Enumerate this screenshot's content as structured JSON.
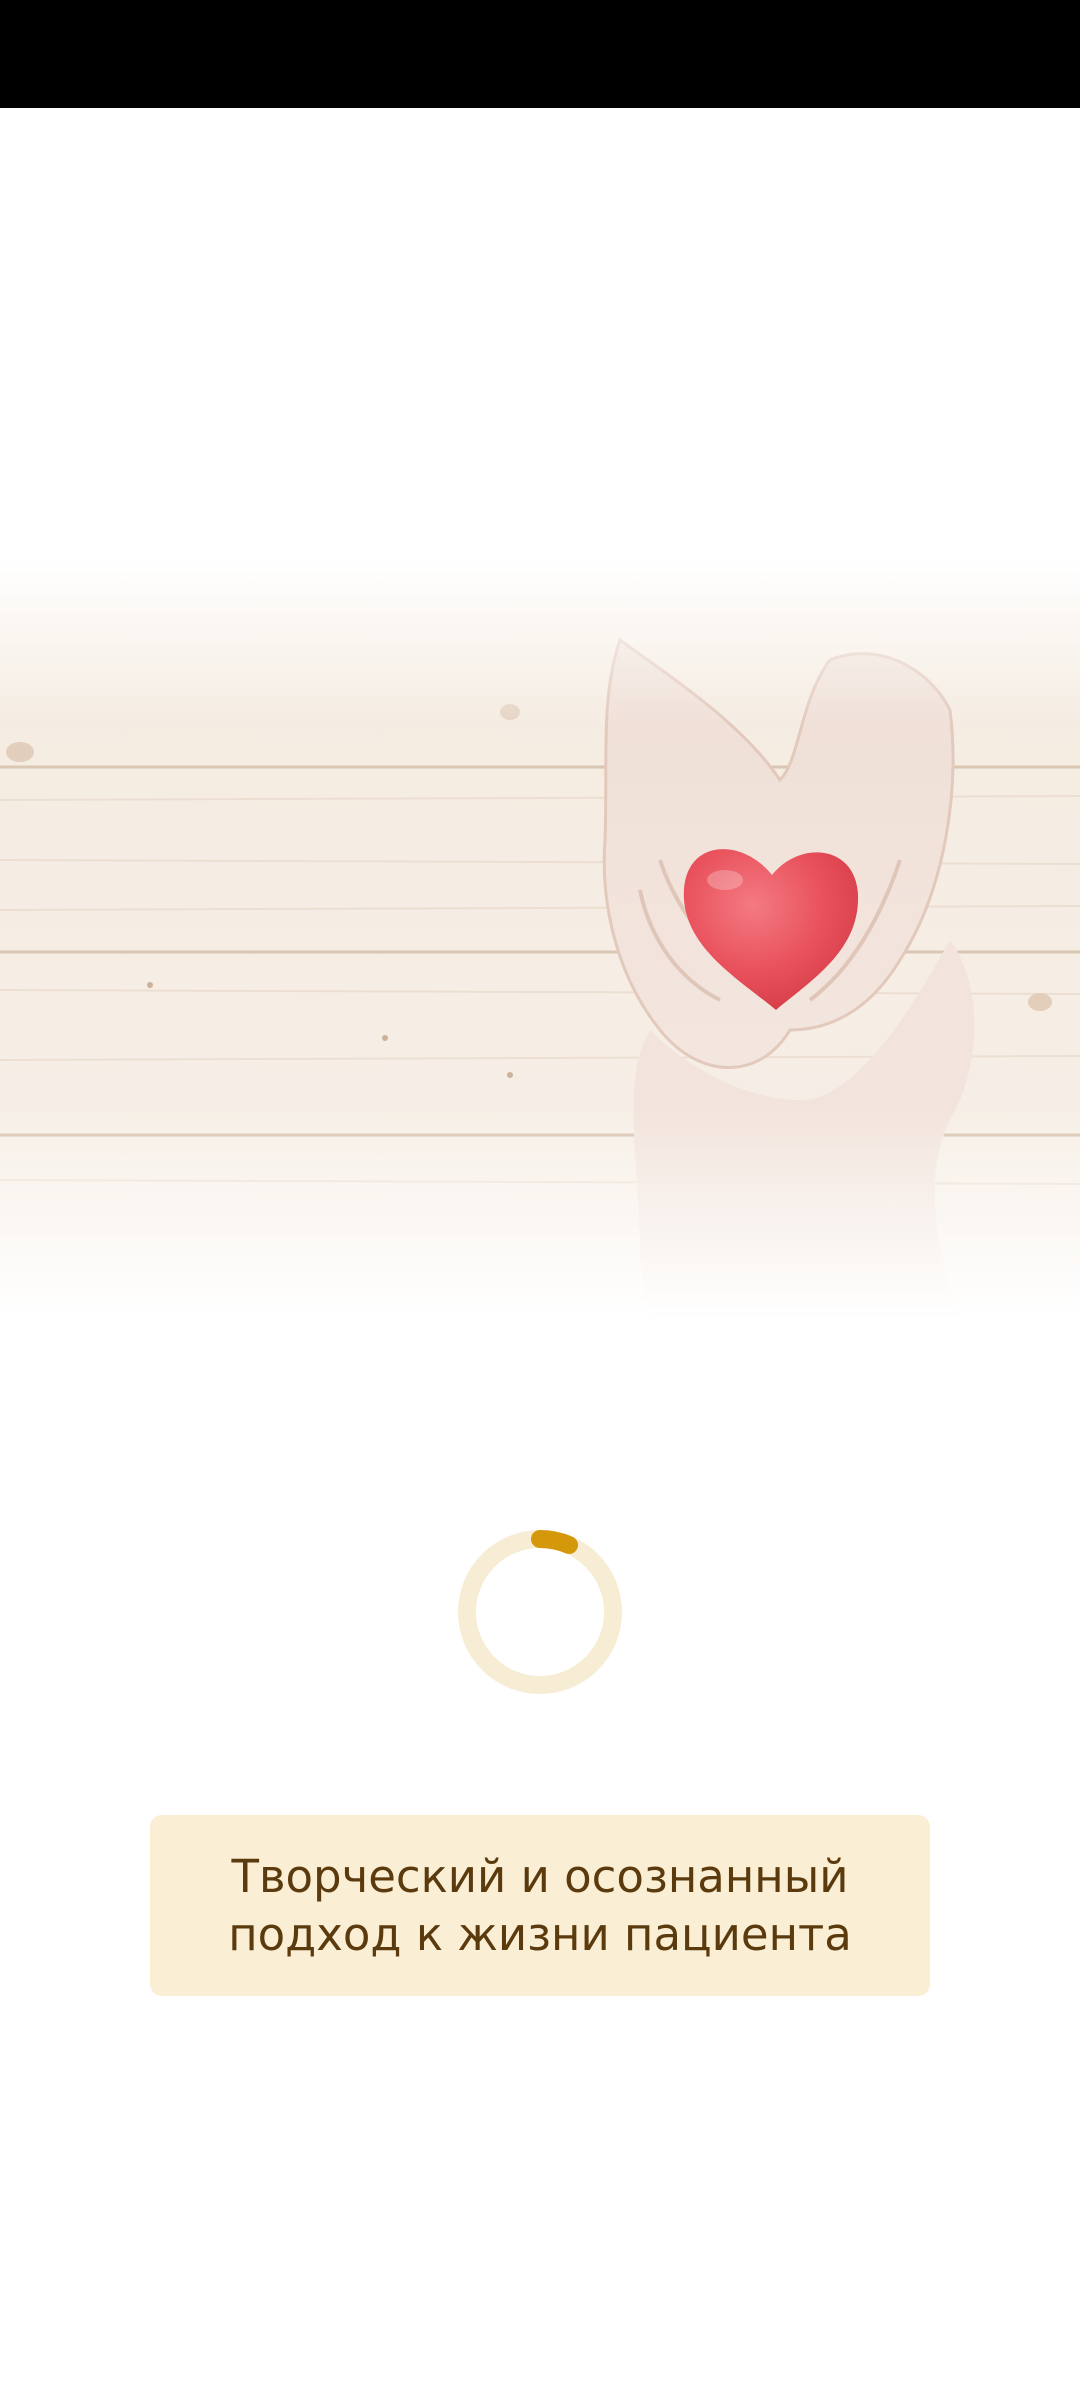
{
  "splash": {
    "tagline": "Творческий и осознанный\nподход к жизни пациента"
  },
  "hero": {
    "icon": "hands-holding-heart-illustration"
  },
  "loader": {
    "icon": "loading-spinner-icon"
  },
  "colors": {
    "status_bar": "#000000",
    "background": "#ffffff",
    "accent": "#d4980a",
    "spinner_track": "#f7ecd4",
    "card_background": "#faefd4",
    "tagline_text": "#5b3a0e",
    "heart": "#e8505b"
  }
}
